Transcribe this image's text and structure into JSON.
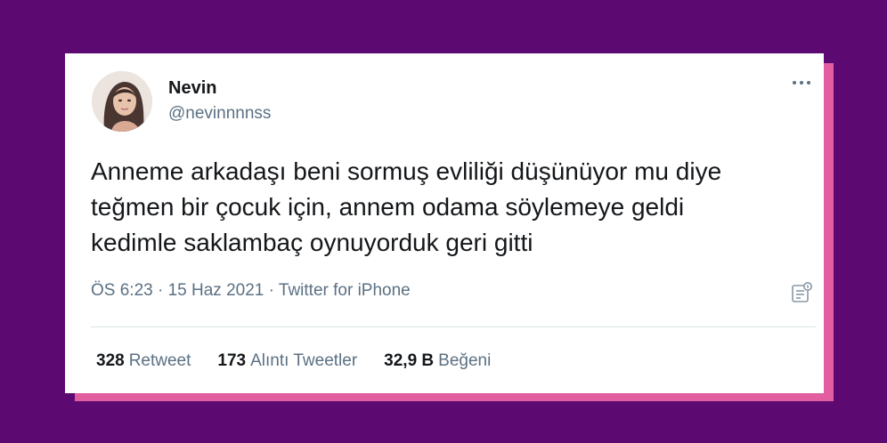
{
  "tweet": {
    "author": {
      "name": "Nevin",
      "handle": "@nevinnnnss"
    },
    "text_lines": [
      "Anneme arkadaşı beni sormuş evliliği düşünüyor mu diye",
      "teğmen bir çocuk için, annem odama söylemeye geldi",
      "kedimle saklambaç oynuyorduk geri gitti"
    ],
    "meta": {
      "time": "ÖS 6:23",
      "date": "15 Haz 2021",
      "source": "Twitter for iPhone",
      "separator": "·"
    },
    "stats": [
      {
        "value": "328",
        "label": "Retweet"
      },
      {
        "value": "173",
        "label": "Alıntı Tweetler"
      },
      {
        "value": "32,9 B",
        "label": "Beğeni"
      }
    ]
  },
  "icons": {
    "more": "more-horizontal-icon",
    "analytics": "analytics-icon"
  },
  "colors": {
    "background": "#5c0a71",
    "accent_shadow": "#e25ea0",
    "card": "#ffffff",
    "text": "#14171a",
    "muted": "#5b7083"
  }
}
